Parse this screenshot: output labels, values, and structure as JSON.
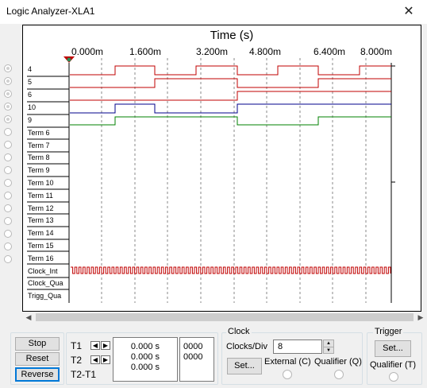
{
  "window": {
    "title": "Logic Analyzer-XLA1",
    "close_glyph": "✕"
  },
  "chart": {
    "axis_title": "Time (s)",
    "ticks": [
      "0.000m",
      "1.600m",
      "3.200m",
      "4.800m",
      "6.400m",
      "8.000m"
    ],
    "channels": [
      {
        "label": "4",
        "color": "#c00000",
        "edges": [
          0,
          0,
          1,
          2,
          1,
          2,
          1,
          0,
          1,
          2,
          1,
          2,
          0
        ]
      },
      {
        "label": "5",
        "color": "#c00000"
      },
      {
        "label": "6",
        "color": "#c00000"
      },
      {
        "label": "10",
        "color": "#00008b"
      },
      {
        "label": "9",
        "color": "#008000"
      },
      {
        "label": "Term 6"
      },
      {
        "label": "Term 7"
      },
      {
        "label": "Term 8"
      },
      {
        "label": "Term 9"
      },
      {
        "label": "Term 10"
      },
      {
        "label": "Term 11"
      },
      {
        "label": "Term 12"
      },
      {
        "label": "Term 13"
      },
      {
        "label": "Term 14"
      },
      {
        "label": "Term 15"
      },
      {
        "label": "Term 16"
      },
      {
        "label": "Clock_Int",
        "color": "#c00000"
      },
      {
        "label": "Clock_Qua"
      },
      {
        "label": "Trigg_Qua"
      }
    ]
  },
  "scrollbar": {
    "left_glyph": "◀",
    "right_glyph": "▶"
  },
  "controls": {
    "stop": "Stop",
    "reset": "Reset",
    "reverse": "Reverse",
    "t1": "T1",
    "t2": "T2",
    "t2t1": "T2-T1",
    "t1_value": "0.000 s",
    "t2_value": "0.000 s",
    "t2t1_value": "0.000 s",
    "t1_hex": "0000",
    "t2_hex": "0000",
    "left_arrow": "◀",
    "right_arrow": "▶"
  },
  "clock": {
    "group": "Clock",
    "clocks_per_div_label": "Clocks/Div",
    "clocks_per_div_value": "8",
    "set": "Set...",
    "external": "External (C)",
    "qualifier": "Qualifier (Q)"
  },
  "trigger": {
    "group": "Trigger",
    "set": "Set...",
    "qualifier": "Qualifier (T)"
  }
}
